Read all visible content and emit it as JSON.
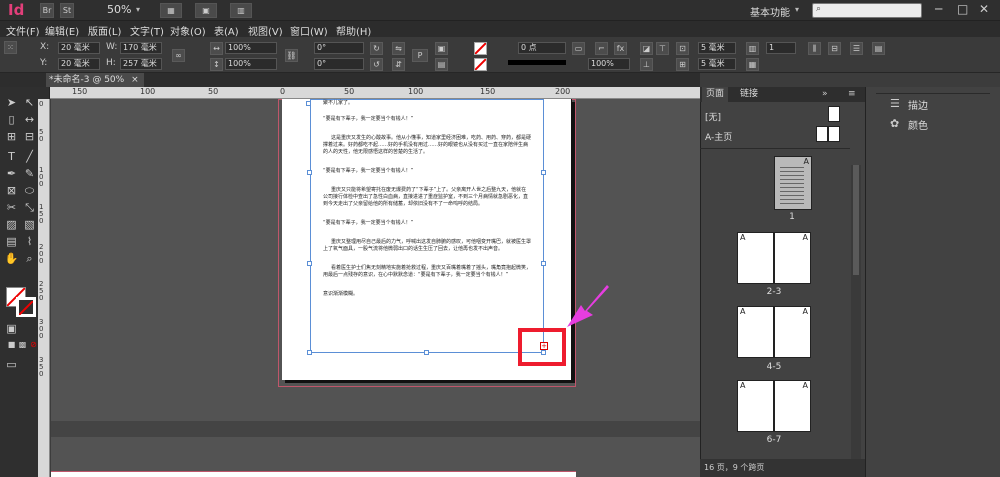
{
  "app": {
    "icon_text": "Id",
    "bridge_label": "Br",
    "stock_label": "St",
    "zoom": "50%",
    "workspace": "基本功能",
    "search_placeholder": ""
  },
  "menu": [
    "文件(F)",
    "编辑(E)",
    "版面(L)",
    "文字(T)",
    "对象(O)",
    "表(A)",
    "视图(V)",
    "窗口(W)",
    "帮助(H)"
  ],
  "control": {
    "x_label": "X:",
    "x_value": "20 毫米",
    "y_label": "Y:",
    "y_value": "20 毫米",
    "w_label": "W:",
    "w_value": "170 毫米",
    "h_label": "H:",
    "h_value": "257 毫米",
    "scale_x": "100%",
    "scale_y": "100%",
    "rotate": "0°",
    "shear": "0°",
    "stroke_weight": "0 点",
    "opacity": "100%",
    "spacing": "5 毫米",
    "spacing2": "5 毫米",
    "columns": "1"
  },
  "document": {
    "tab_title": "*未命名-3 @ 50%",
    "tab_close": "×",
    "ruler_top": [
      "150",
      "100",
      "50",
      "0",
      "50",
      "100",
      "150",
      "200"
    ],
    "ruler_left": [
      "0",
      "5",
      "0",
      "1",
      "0",
      "0",
      "1",
      "5",
      "0",
      "2",
      "0",
      "0",
      "2",
      "5",
      "0",
      "3",
      "0",
      "0",
      "3",
      "5",
      "0"
    ],
    "paragraphs": [
      "聚不儿家了。",
      "“要是有下辈子，我一定要当个有钱人！”",
      "这是重庆又发生的心酸故事。他从小懂事，知道家里经济困难，吃药、用药、穿药，都是硬撑着过来。好药都吃不起……好的手机没有用过……好的眼镜也从没有买过一直在家陪伴生病的人的天性，他无限感悟这样的苦楚的生活了。",
      "“要是有下辈子，我一定要当个有钱人！”",
      "重庆又只能将希望寄托在废无爆费药了“下辈子”上了。父亲离开人世之后整九天，他就在公司接行体检中查出了急性白血病，直接进进了重症监护室，不到三个月病情就急剧恶化，直到今天走出了父亲留给他的所有储蓄，却依旧没有不了一命呜呼的结局。",
      "“要是有下辈子，我一定要当个有钱人！”",
      "重庆又整理用尽自己最后的力气，呼喊出这发自肺腑的感叹，可他咽变开嘴巴，就被医生罩上了氧气面具，一股气流将他微弱出口的话生生压了回去，让他再也发不出声音。",
      "看着医生护士们焦无刻精地实施着抢救过程，重庆又百嘴着嘴着了摇头，嘴角竟抱起微笑，用最后一点残存的意识，在心中默默念道：“要是有下辈子，我一定要当个有钱人！”",
      "意识渐渐模糊。"
    ],
    "overset_symbol": "+"
  },
  "pages_panel": {
    "tab_pages": "页面",
    "tab_links": "链接",
    "none_master": "[无]",
    "a_master": "A-主页",
    "thumbs": [
      {
        "label": "1",
        "left": "",
        "right": "A"
      },
      {
        "label": "2-3",
        "left": "A",
        "right": "A"
      },
      {
        "label": "4-5",
        "left": "A",
        "right": "A"
      },
      {
        "label": "6-7",
        "left": "A",
        "right": "A"
      }
    ],
    "status": "16 页，9 个跨页"
  },
  "dock": {
    "items": [
      "描边",
      "颜色"
    ]
  },
  "colors": {
    "accent": "#e23f7a",
    "highlight_box": "#ee1c2e",
    "arrow": "#e63de0",
    "frame": "#5b8fd6"
  }
}
